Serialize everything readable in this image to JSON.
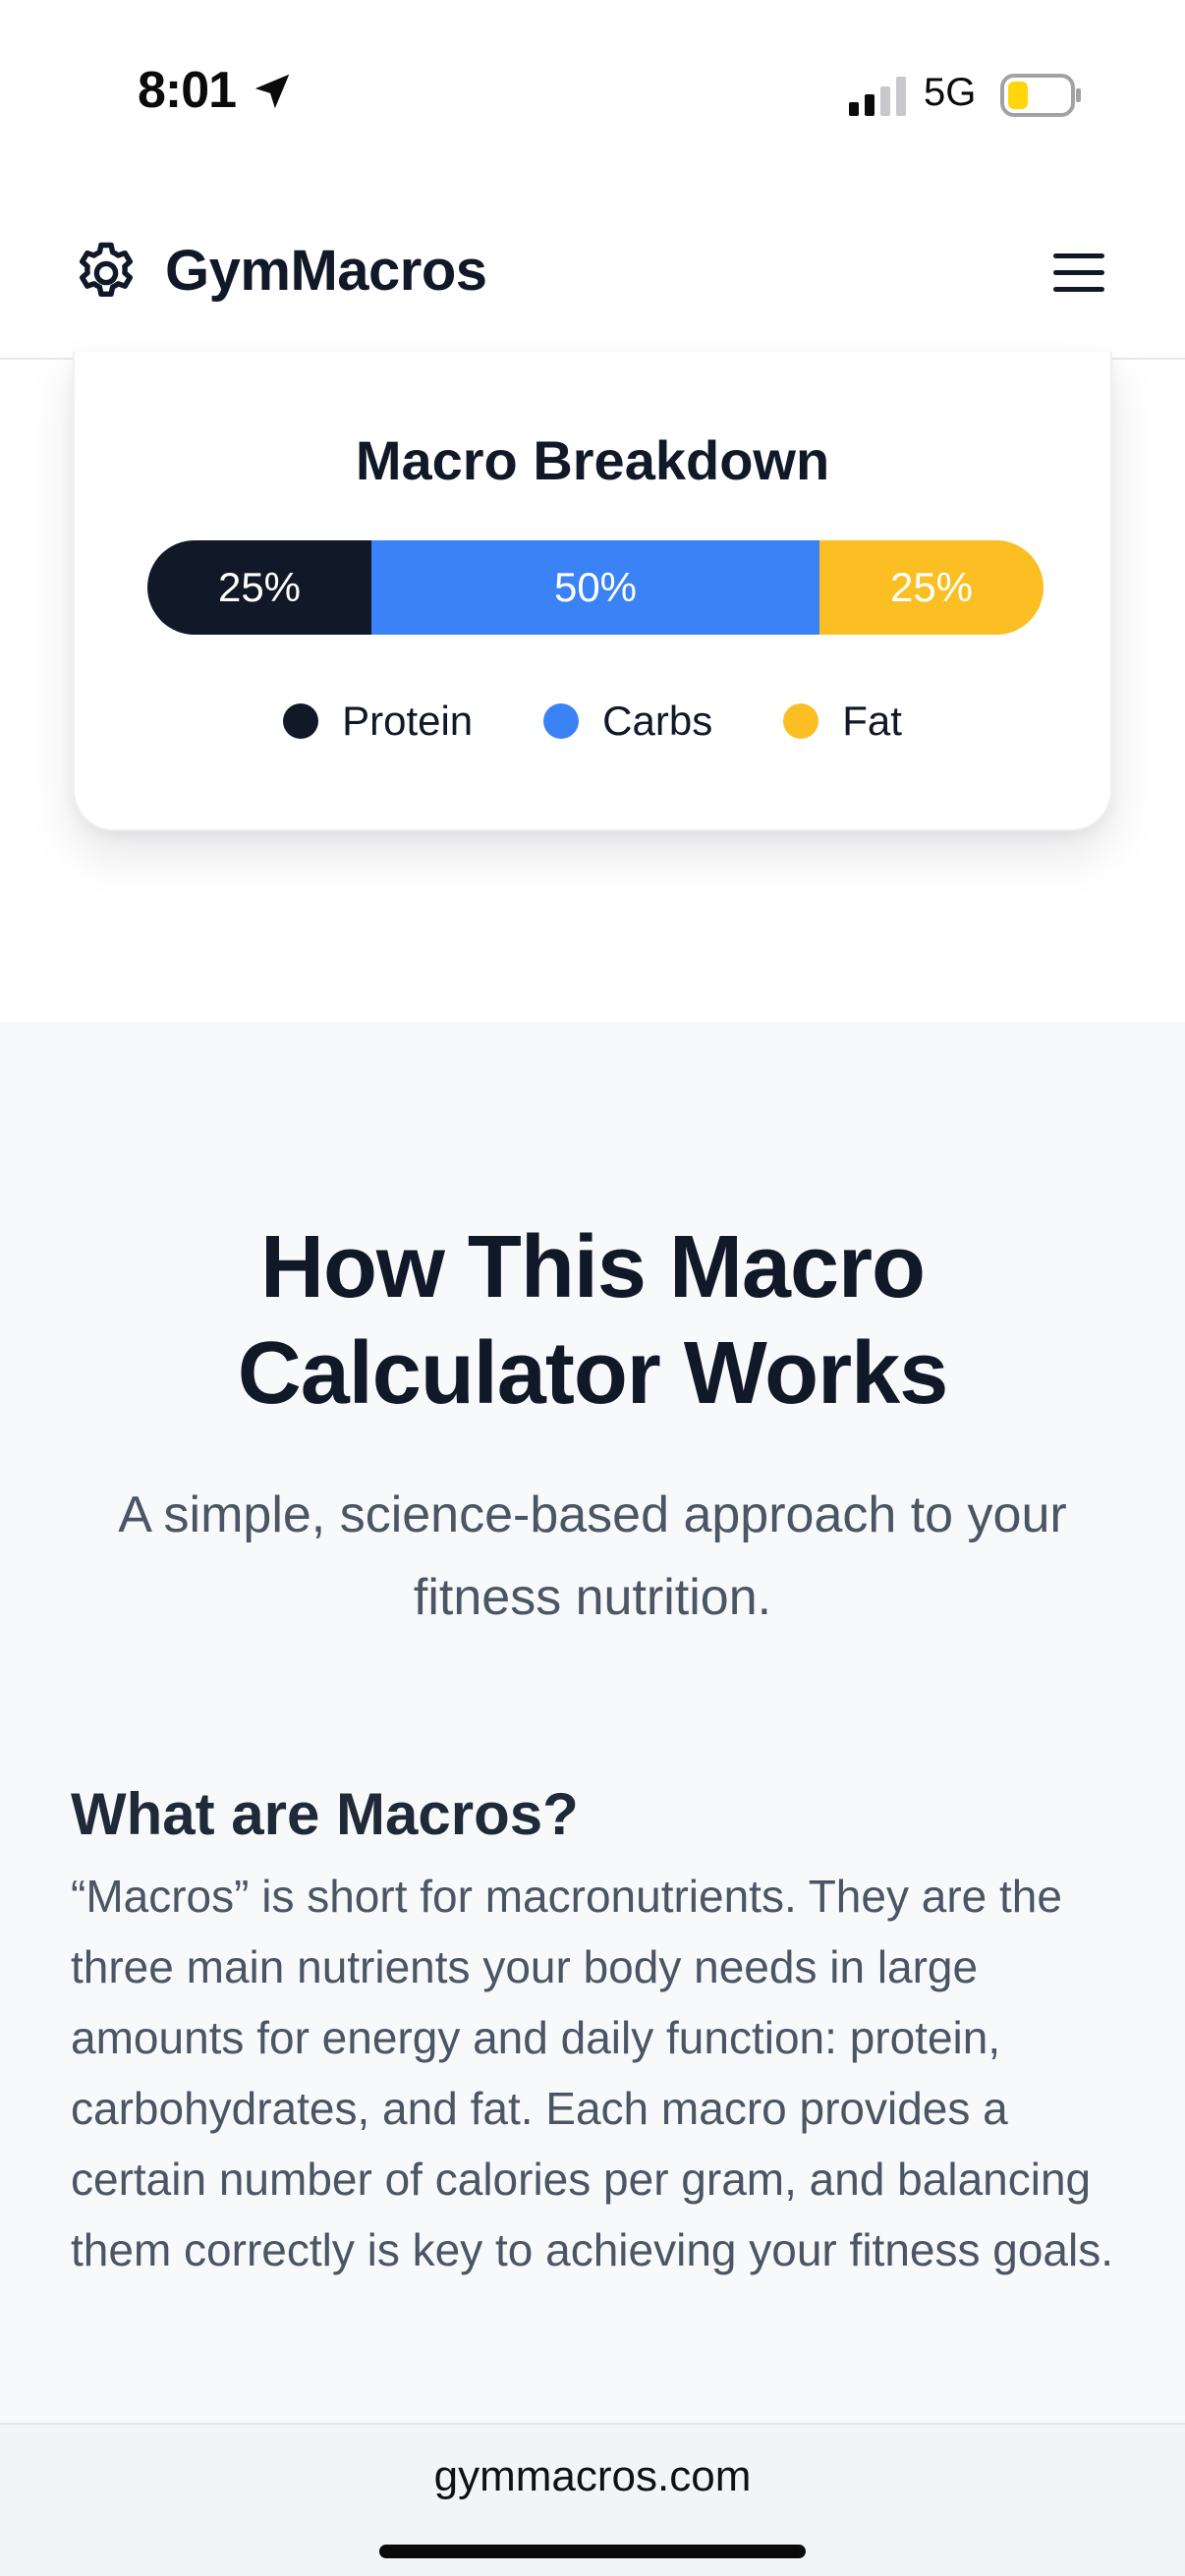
{
  "status_bar": {
    "time": "8:01",
    "network": "5G",
    "icons": [
      "location-arrow-icon",
      "signal-icon",
      "battery-icon"
    ]
  },
  "header": {
    "brand": "GymMacros",
    "logo_icon": "gear-icon",
    "menu_icon": "hamburger-menu-icon"
  },
  "breakdown": {
    "title": "Macro Breakdown",
    "segments": [
      {
        "label": "25%",
        "percent": 25,
        "color": "#111827"
      },
      {
        "label": "50%",
        "percent": 50,
        "color": "#3b82f6"
      },
      {
        "label": "25%",
        "percent": 25,
        "color": "#fbbf24"
      }
    ],
    "legend": [
      {
        "label": "Protein",
        "color": "#111827"
      },
      {
        "label": "Carbs",
        "color": "#3b82f6"
      },
      {
        "label": "Fat",
        "color": "#fbbf24"
      }
    ]
  },
  "how": {
    "title_line1": "How This Macro",
    "title_line2": "Calculator Works",
    "subtitle": "A simple, science-based approach to your fitness nutrition.",
    "section_title": "What are Macros?",
    "section_body": "“Macros” is short for macronutrients. They are the three main nutrients your body needs in large amounts for energy and daily function: protein, carbohydrates, and fat. Each macro provides a certain number of calories per gram, and balancing them correctly is key to achieving your fitness goals."
  },
  "browser": {
    "url": "gymmacros.com"
  },
  "colors": {
    "dark": "#111827",
    "blue": "#3b82f6",
    "yellow": "#fbbf24",
    "muted_text": "#4b5563"
  }
}
